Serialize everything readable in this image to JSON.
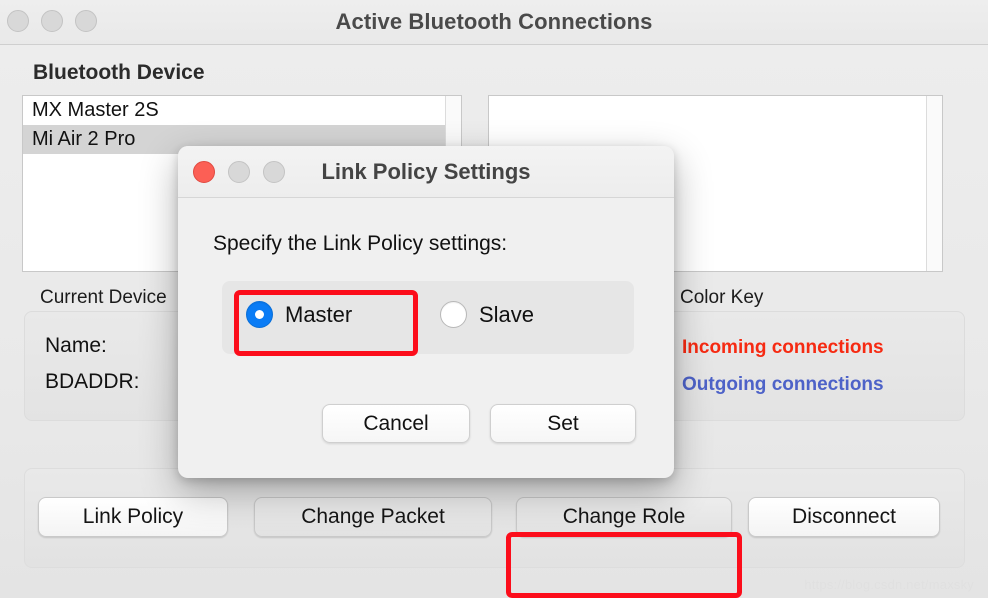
{
  "window": {
    "title": "Active Bluetooth Connections",
    "traffic_lights": [
      {
        "name": "close-button",
        "state": "inactive"
      },
      {
        "name": "minimize-button",
        "state": "inactive"
      },
      {
        "name": "zoom-button",
        "state": "inactive"
      }
    ]
  },
  "main": {
    "section_heading": "Bluetooth Device",
    "device_list": [
      {
        "label": "MX Master 2S",
        "selected": false
      },
      {
        "label": "Mi Air 2 Pro",
        "selected": true
      }
    ],
    "detail_list": [],
    "current_device": {
      "label": "Current Device",
      "rows": [
        {
          "key": "Name:",
          "value": ""
        },
        {
          "key": "BDADDR:",
          "value": ""
        }
      ]
    },
    "color_key": {
      "label": "Color Key",
      "entries": [
        {
          "text": "Incoming connections",
          "color": "#f62a12"
        },
        {
          "text": "Outgoing connections",
          "color": "#4d62c8"
        }
      ]
    },
    "toolbar": {
      "link_policy": "Link Policy",
      "change_packet": "Change Packet",
      "change_role": "Change Role",
      "disconnect": "Disconnect"
    }
  },
  "dialog": {
    "title": "Link Policy Settings",
    "prompt": "Specify the Link Policy settings:",
    "traffic_lights": [
      {
        "name": "close-button",
        "state": "active",
        "color": "#fc5f55"
      },
      {
        "name": "minimize-button",
        "state": "inactive"
      },
      {
        "name": "zoom-button",
        "state": "inactive"
      }
    ],
    "radio_options": [
      {
        "label": "Master",
        "checked": true
      },
      {
        "label": "Slave",
        "checked": false
      }
    ],
    "buttons": {
      "cancel": "Cancel",
      "set": "Set"
    }
  },
  "annotations": {
    "color": "#fc0d1b",
    "highlighted": [
      "Master",
      "Change Role"
    ]
  },
  "watermark": "https://blog.csdn.net/maxsky"
}
